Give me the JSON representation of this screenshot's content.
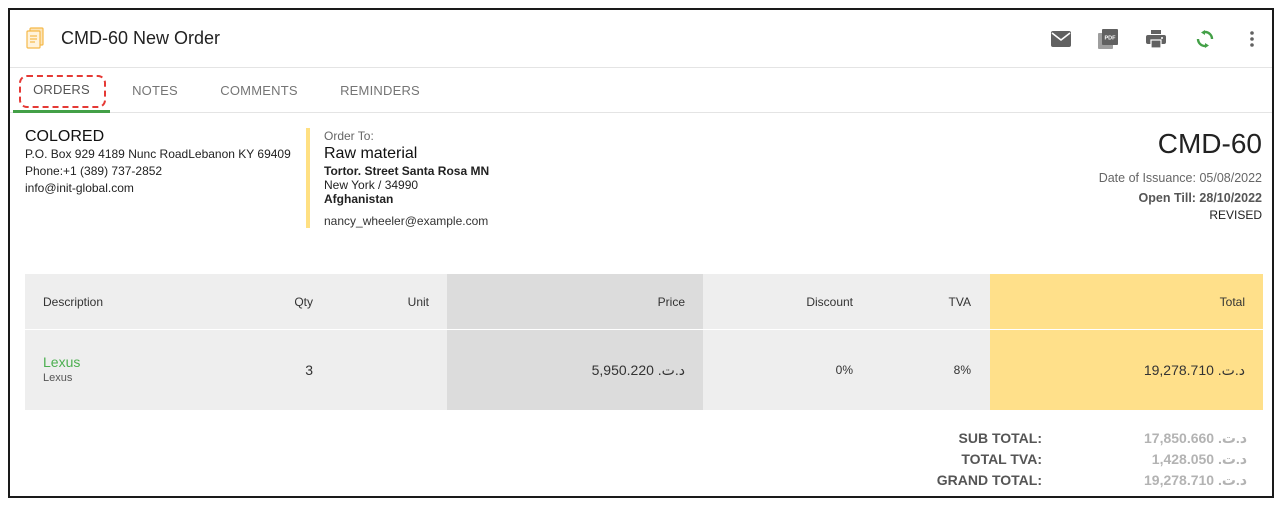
{
  "header": {
    "title": "CMD-60 New Order",
    "actions": [
      {
        "icon": "mail-icon",
        "label": "Email"
      },
      {
        "icon": "pdf-icon",
        "label": "PDF"
      },
      {
        "icon": "print-icon",
        "label": "Print"
      },
      {
        "icon": "sync-icon",
        "label": "Convert"
      },
      {
        "icon": "more-vert-icon",
        "label": "More"
      }
    ],
    "pdf_badge": "PDF"
  },
  "tabs": [
    {
      "label": "ORDERS",
      "active": true
    },
    {
      "label": "NOTES",
      "active": false
    },
    {
      "label": "COMMENTS",
      "active": false
    },
    {
      "label": "REMINDERS",
      "active": false
    }
  ],
  "company": {
    "name": "COLORED",
    "address": "P.O. Box 929 4189 Nunc RoadLebanon KY 69409",
    "phone": "Phone:+1 (389) 737-2852",
    "email": "info@init-global.com"
  },
  "order_to": {
    "label": "Order To:",
    "client": "Raw material",
    "street": "Tortor. Street Santa Rosa MN",
    "city": "New York / 34990",
    "country": "Afghanistan",
    "email": "nancy_wheeler@example.com"
  },
  "document": {
    "number": "CMD-60",
    "date_of_issuance": "Date of Issuance: 05/08/2022",
    "open_till": "Open Till: 28/10/2022",
    "status": "REVISED"
  },
  "table": {
    "columns": [
      "Description",
      "Qty",
      "Unit",
      "Price",
      "Discount",
      "TVA",
      "Total"
    ],
    "rows": [
      {
        "description": "Lexus",
        "sub_description": "Lexus",
        "qty": "3",
        "unit": "",
        "price": "د.ت. 5,950.220",
        "discount": "0%",
        "tva": "8%",
        "total": "د.ت. 19,278.710"
      }
    ]
  },
  "totals": {
    "sub_total_label": "SUB TOTAL:",
    "sub_total_value": "د.ت. 17,850.660",
    "total_tva_label": "TOTAL TVA:",
    "total_tva_value": "د.ت. 1,428.050",
    "grand_total_label": "GRAND TOTAL:",
    "grand_total_value": "د.ت. 19,278.710"
  },
  "colors": {
    "accent_green": "#43a047",
    "highlight_yellow": "#ffe08a",
    "annotation_red": "#e53935"
  }
}
